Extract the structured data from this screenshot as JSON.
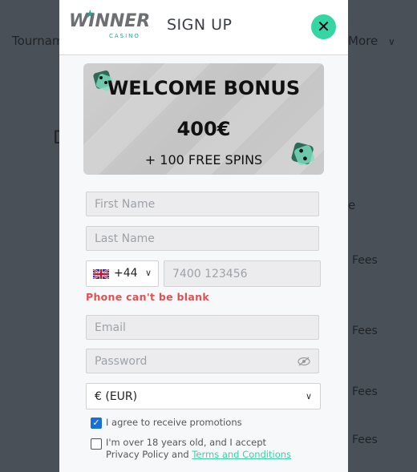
{
  "backdrop": {
    "nav_tournaments": "Tournam",
    "nav_more": "More",
    "more_chevron_icon": "chevron-down",
    "letter_d": "D",
    "letter_e": "e",
    "fees": [
      "Fees",
      "Fees",
      "Fees",
      "Fees"
    ]
  },
  "header": {
    "logo_text": "WINNER",
    "logo_sub": "CASINO",
    "title": "SIGN UP",
    "close_icon": "x"
  },
  "banner": {
    "title": "WELCOME BONUS",
    "amount": "400€",
    "spins": "+ 100 FREE SPINS"
  },
  "form": {
    "first_name_placeholder": "First Name",
    "last_name_placeholder": "Last Name",
    "phone_code": "+44",
    "phone_placeholder": "7400 123456",
    "phone_error": "Phone can't be blank",
    "email_placeholder": "Email",
    "password_placeholder": "Password",
    "currency": "€ (EUR)"
  },
  "checkboxes": {
    "promotions_label": "I agree to receive promotions",
    "promotions_checked": true,
    "age_label_line1": "I'm over 18 years old, and I accept",
    "age_label_line2_prefix": "Privacy Policy and ",
    "age_label_link": "Terms and Conditions",
    "age_checked": false
  },
  "colors": {
    "accent": "#35d6a3",
    "error": "#e25050",
    "checkbox": "#1a6fd6"
  }
}
